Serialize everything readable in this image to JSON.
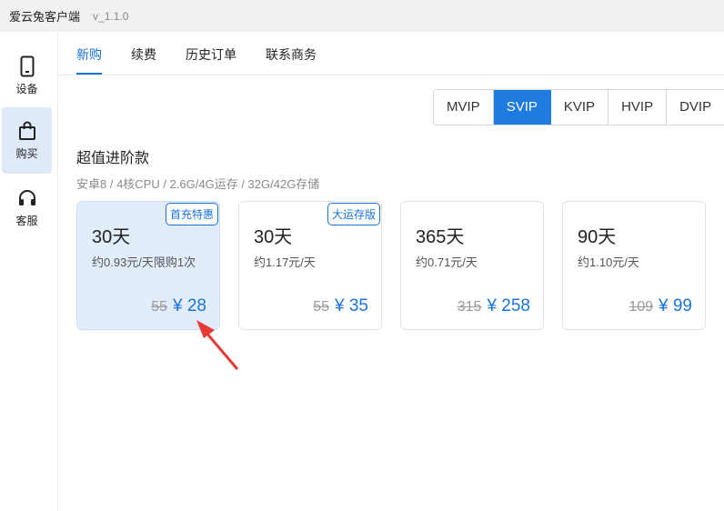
{
  "titlebar": {
    "app_name": "爱云兔客户端",
    "version": "v_1.1.0"
  },
  "sidebar": {
    "items": [
      {
        "label": "设备",
        "icon": "phone-icon"
      },
      {
        "label": "购买",
        "icon": "shopping-bag-icon"
      },
      {
        "label": "客服",
        "icon": "headset-icon"
      }
    ]
  },
  "tabs": [
    "新购",
    "续费",
    "历史订单",
    "联系商务"
  ],
  "vip_tiers": [
    "MVIP",
    "SVIP",
    "KVIP",
    "HVIP",
    "DVIP"
  ],
  "section": {
    "title": "超值进阶款",
    "subtitle": "安卓8 / 4核CPU / 2.6G/4G运存 / 32G/42G存储"
  },
  "plans": [
    {
      "days": "30天",
      "per_day": "约0.93元/天限购1次",
      "old_price": "55",
      "price": "¥ 28",
      "badge": "首充特惠"
    },
    {
      "days": "30天",
      "per_day": "约1.17元/天",
      "old_price": "55",
      "price": "¥ 35",
      "badge": "大运存版"
    },
    {
      "days": "365天",
      "per_day": "约0.71元/天",
      "old_price": "315",
      "price": "¥ 258",
      "badge": ""
    },
    {
      "days": "90天",
      "per_day": "约1.10元/天",
      "old_price": "109",
      "price": "¥ 99",
      "badge": ""
    }
  ],
  "colors": {
    "accent": "#1a73d9",
    "selected_bg": "#e2edfb",
    "annotation": "#e53935"
  }
}
